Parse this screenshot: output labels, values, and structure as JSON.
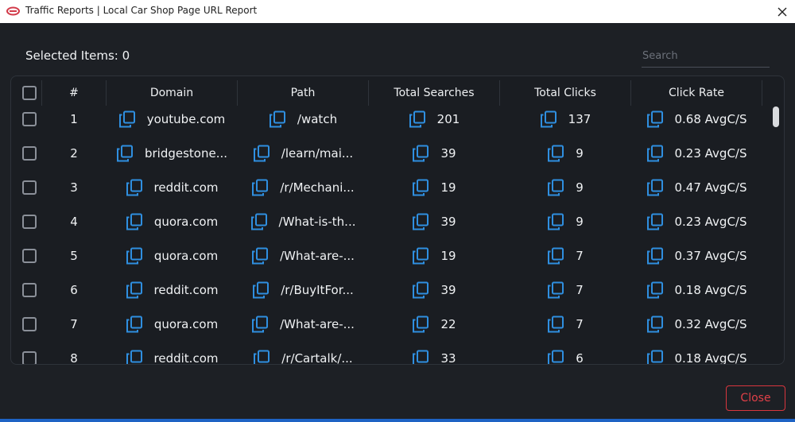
{
  "window": {
    "title": "Traffic Reports | Local Car Shop Page URL Report",
    "close_glyph": "✕"
  },
  "header": {
    "selected_label": "Selected Items: 0"
  },
  "search": {
    "placeholder": "Search",
    "value": ""
  },
  "table": {
    "columns": [
      "#",
      "Domain",
      "Path",
      "Total Searches",
      "Total Clicks",
      "Click Rate"
    ],
    "rows": [
      {
        "num": "1",
        "domain": "youtube.com",
        "path": "/watch",
        "searches": "201",
        "clicks": "137",
        "rate": "0.68 AvgC/S"
      },
      {
        "num": "2",
        "domain": "bridgestone...",
        "path": "/learn/mai...",
        "searches": "39",
        "clicks": "9",
        "rate": "0.23 AvgC/S"
      },
      {
        "num": "3",
        "domain": "reddit.com",
        "path": "/r/Mechani...",
        "searches": "19",
        "clicks": "9",
        "rate": "0.47 AvgC/S"
      },
      {
        "num": "4",
        "domain": "quora.com",
        "path": "/What-is-th...",
        "searches": "39",
        "clicks": "9",
        "rate": "0.23 AvgC/S"
      },
      {
        "num": "5",
        "domain": "quora.com",
        "path": "/What-are-...",
        "searches": "19",
        "clicks": "7",
        "rate": "0.37 AvgC/S"
      },
      {
        "num": "6",
        "domain": "reddit.com",
        "path": "/r/BuyItFor...",
        "searches": "39",
        "clicks": "7",
        "rate": "0.18 AvgC/S"
      },
      {
        "num": "7",
        "domain": "quora.com",
        "path": "/What-are-...",
        "searches": "22",
        "clicks": "7",
        "rate": "0.32 AvgC/S"
      },
      {
        "num": "8",
        "domain": "reddit.com",
        "path": "/r/Cartalk/...",
        "searches": "33",
        "clicks": "6",
        "rate": "0.18 AvgC/S"
      }
    ]
  },
  "footer": {
    "close_label": "Close"
  },
  "colors": {
    "background": "#1d2025",
    "accent_blue": "#2f8fe0",
    "close_red": "#d9363e",
    "text": "#eef0f2"
  },
  "icons": {
    "app": "link-icon",
    "copy": "copy-icon",
    "close": "close-icon"
  }
}
